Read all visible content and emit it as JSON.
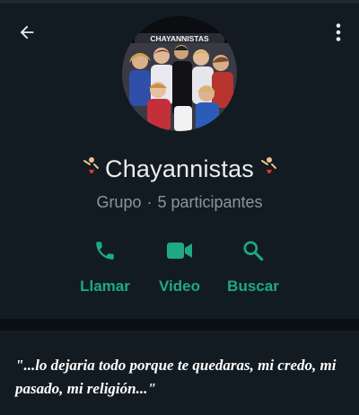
{
  "group": {
    "name": "Chayannistas",
    "type_label": "Grupo",
    "separator": "·",
    "participants": "5 participantes",
    "avatar_banner_text": "CHAYANNISTAS"
  },
  "actions": [
    {
      "label": "Llamar",
      "icon": "phone-icon"
    },
    {
      "label": "Video",
      "icon": "video-camera-icon"
    },
    {
      "label": "Buscar",
      "icon": "search-icon"
    }
  ],
  "description": "\"...lo dejaria todo porque te quedaras, mi credo, mi pasado, mi religión...\"",
  "colors": {
    "background": "#121b22",
    "accent": "#1fa884",
    "primary_text": "#e9edef",
    "secondary_text": "#8696a0"
  }
}
